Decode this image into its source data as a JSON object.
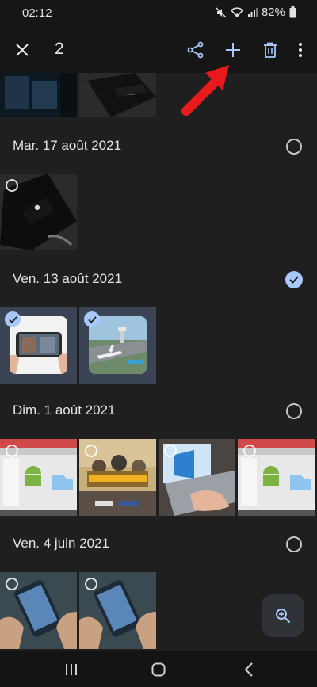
{
  "status": {
    "time": "02:12",
    "battery": "82%"
  },
  "toolbar": {
    "selected_count": "2"
  },
  "groups": [
    {
      "date": "Mar. 17 août 2021",
      "selected": false
    },
    {
      "date": "Ven. 13 août 2021",
      "selected": true
    },
    {
      "date": "Dim. 1 août 2021",
      "selected": false
    },
    {
      "date": "Ven. 4 juin 2021",
      "selected": false
    }
  ],
  "thumbnails": {
    "top_partial": [
      "dark-device-photo",
      "black-device-on-table"
    ],
    "aug17": [
      "phone-on-charger"
    ],
    "aug13": [
      {
        "name": "phone-video-call",
        "selected": true
      },
      {
        "name": "airport-game-screenshot",
        "selected": true
      }
    ],
    "aug1": [
      "android-transfer-screen",
      "battlegrounds-poster",
      "laptop-windows-screen",
      "android-transfer-screen-2"
    ],
    "jun4": [
      "hands-holding-phone",
      "hands-holding-phone-2"
    ]
  },
  "icons": {
    "close": "close-icon",
    "share": "share-icon",
    "add": "plus-icon",
    "delete": "trash-icon",
    "more": "more-vert-icon",
    "zoom": "zoom-in-icon"
  },
  "colors": {
    "accent": "#a8c7fa",
    "arrow": "#e8191b",
    "selected_bg": "#3b4454"
  }
}
